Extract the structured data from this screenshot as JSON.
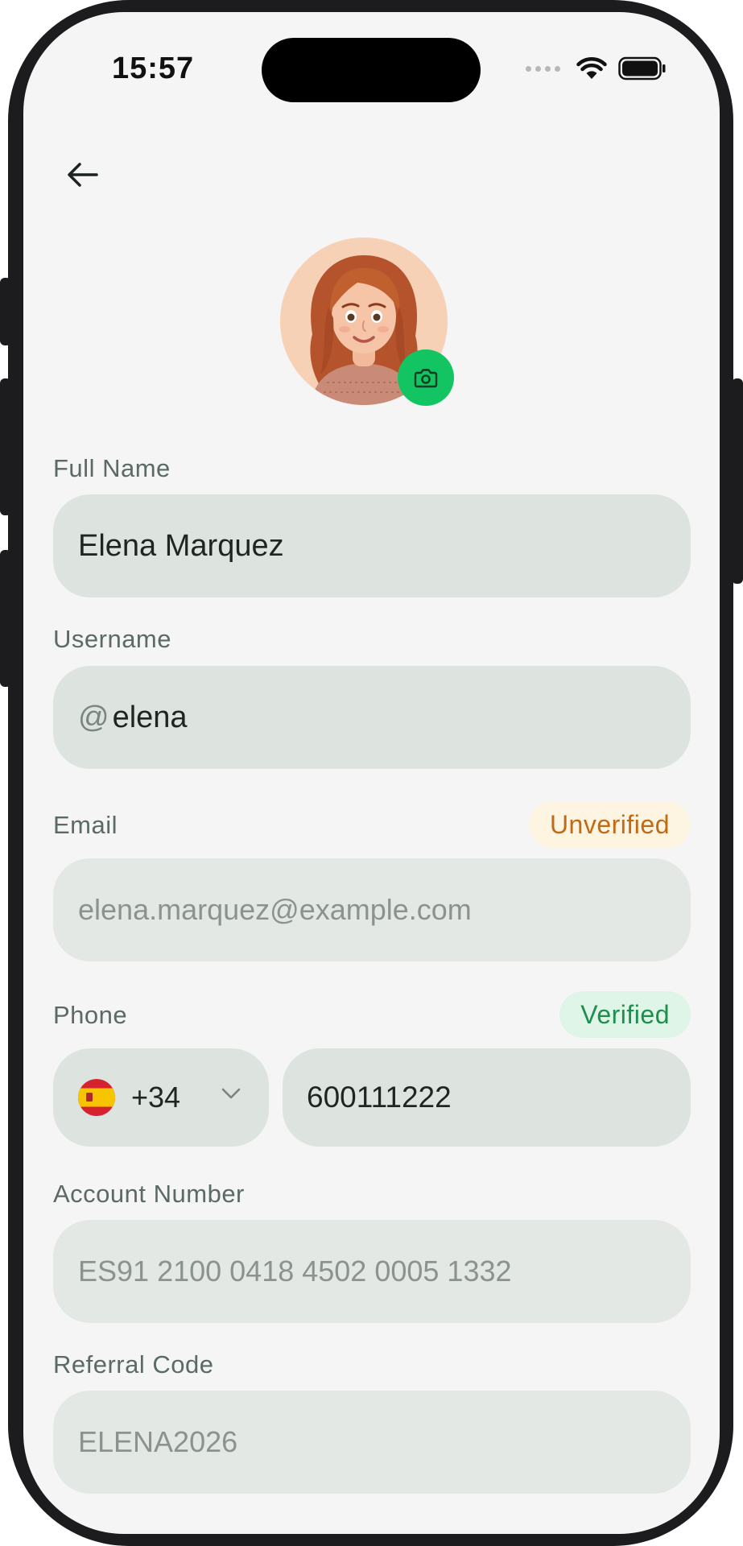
{
  "status_bar": {
    "time": "15:57"
  },
  "form": {
    "full_name": {
      "label": "Full Name",
      "value": "Elena Marquez"
    },
    "username": {
      "label": "Username",
      "prefix": "@",
      "value": "elena"
    },
    "email": {
      "label": "Email",
      "value": "elena.marquez@example.com",
      "badge": "Unverified"
    },
    "phone": {
      "label": "Phone",
      "country_code": "+34",
      "country_flag": "spain-flag-icon",
      "value": "600111222",
      "badge": "Verified"
    },
    "account_number": {
      "label": "Account Number",
      "value": "ES91 2100 0418 4502 0005 1332"
    },
    "referral_code": {
      "label": "Referral Code",
      "value": "ELENA2026"
    }
  },
  "colors": {
    "accent": "#12c462",
    "unverified": "#c06a16",
    "verified": "#1d8f4d",
    "field_bg": "#dde3df",
    "screen_bg": "#f4f5f4"
  }
}
